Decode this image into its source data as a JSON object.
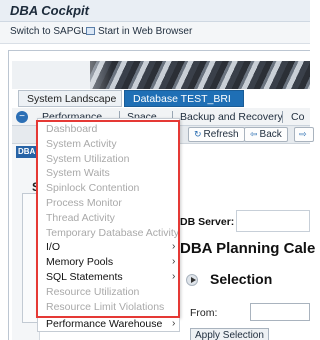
{
  "app": {
    "title": "DBA Cockpit"
  },
  "toolbar": {
    "switch_label": "Switch to SAPGUI",
    "browser_label": "Start in Web Browser"
  },
  "tabs": [
    {
      "label": "System Landscape"
    },
    {
      "label": "Database TEST_BRI"
    }
  ],
  "menubar": {
    "items": [
      {
        "label": "Performance"
      },
      {
        "label": "Space"
      },
      {
        "label": "Backup and Recovery"
      },
      {
        "label": "Co"
      }
    ]
  },
  "actions": {
    "refresh_label": "Refresh",
    "back_label": "Back"
  },
  "left": {
    "tag": "DBA",
    "letter": "S"
  },
  "main": {
    "db_server_label": "DB Server:",
    "planning_title": "DBA Planning Cale",
    "selection_title": "Selection",
    "from_label": "From:",
    "apply_label": "Apply Selection"
  },
  "performance_menu": {
    "items": [
      {
        "label": "Dashboard",
        "enabled": false,
        "submenu": false
      },
      {
        "label": "System Activity",
        "enabled": false,
        "submenu": false
      },
      {
        "label": "System Utilization",
        "enabled": false,
        "submenu": false
      },
      {
        "label": "System Waits",
        "enabled": false,
        "submenu": false
      },
      {
        "label": "Spinlock Contention",
        "enabled": false,
        "submenu": false
      },
      {
        "label": "Process Monitor",
        "enabled": false,
        "submenu": false
      },
      {
        "label": "Thread Activity",
        "enabled": false,
        "submenu": false
      },
      {
        "label": "Temporary Database Activity",
        "enabled": false,
        "submenu": false
      },
      {
        "label": "I/O",
        "enabled": true,
        "submenu": true
      },
      {
        "label": "Memory Pools",
        "enabled": true,
        "submenu": true
      },
      {
        "label": "SQL Statements",
        "enabled": true,
        "submenu": true
      },
      {
        "label": "Resource Utilization",
        "enabled": false,
        "submenu": false
      },
      {
        "label": "Resource Limit Violations",
        "enabled": false,
        "submenu": false
      }
    ],
    "footer_item": {
      "label": "Performance Warehouse",
      "enabled": true,
      "submenu": true
    }
  },
  "colors": {
    "highlight": "#e53935",
    "tab_active": "#1f6fb5",
    "disabled_text": "#a9a9a9"
  }
}
